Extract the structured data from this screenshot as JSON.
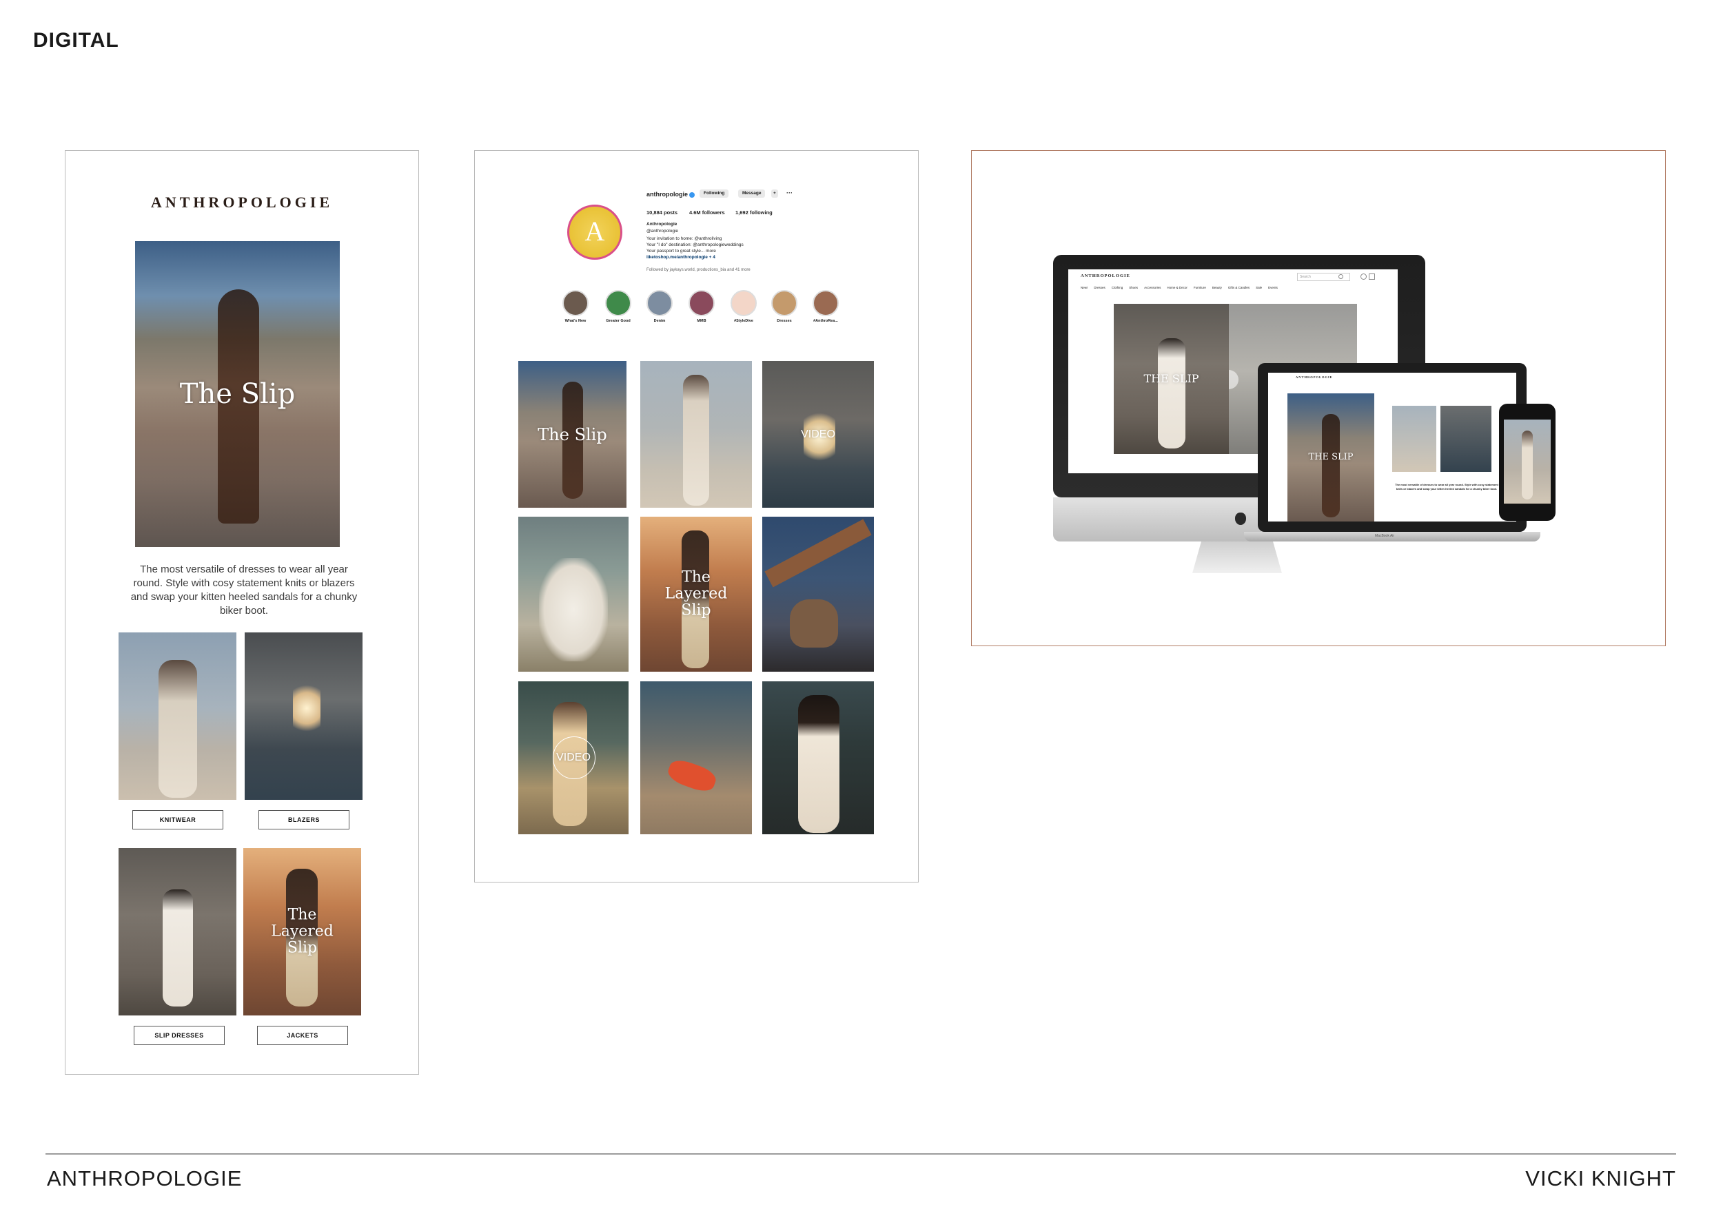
{
  "page": {
    "section_title": "DIGITAL",
    "footer_left": "ANTHROPOLOGIE",
    "footer_right": "VICKI KNIGHT"
  },
  "email": {
    "logo": "ANTHROPOLOGIE",
    "hero_title": "The Slip",
    "body": "The most versatile of dresses to wear all year round. Style with cosy statement knits or blazers and swap your kitten heeled sandals for a chunky biker boot.",
    "tiles": [
      {
        "label": "KNITWEAR",
        "overlay": ""
      },
      {
        "label": "BLAZERS",
        "overlay": ""
      },
      {
        "label": "SLIP DRESSES",
        "overlay": ""
      },
      {
        "label": "JACKETS",
        "overlay": "The Layered Slip"
      }
    ]
  },
  "instagram": {
    "avatar_letter": "A",
    "username": "anthropologie",
    "following_label": "Following",
    "message_label": "Message",
    "add_label": "+",
    "more_label": "···",
    "posts": "10,884 posts",
    "followers": "4.6M followers",
    "following": "1,692 following",
    "name": "Anthropologie",
    "tag": "@anthropologie",
    "bio_1": "Your invitation to home: @anthroliving",
    "bio_2": "Your \"I do\" destination: @anthropologieweddings",
    "bio_3": "Your passport to great style... more",
    "link": "liketoshop.me/anthropologie + 4",
    "followed_by": "Followed by jaykays.world, productions_bia and 41 more",
    "highlights": [
      "What's New",
      "Greater Good",
      "Denim",
      "MMB",
      "#StyleDive",
      "Dresses",
      "#AnthroRea..."
    ],
    "grid_overlays": [
      "The Slip",
      "",
      "VIDEO",
      "",
      "The Layered Slip",
      "",
      "VIDEO",
      "",
      ""
    ]
  },
  "website": {
    "logo": "ANTHROPOLOGIE",
    "search_placeholder": "Search",
    "nav": [
      "New!",
      "Dresses",
      "Clothing",
      "Shoes",
      "Accessories",
      "Home & Decor",
      "Furniture",
      "Beauty",
      "Gifts & Candles",
      "Sale",
      "Events"
    ],
    "hero_text": "THE SLIP",
    "laptop_logo": "ANTHROPOLOGIE",
    "laptop_hero_text": "THE SLIP",
    "laptop_body": "The most versatile of dresses to wear all year round. Style with cosy statement knits or blazers and swap your kitten heeled sandals for a chunky biker boot.",
    "laptop_label": "MacBook Air"
  }
}
